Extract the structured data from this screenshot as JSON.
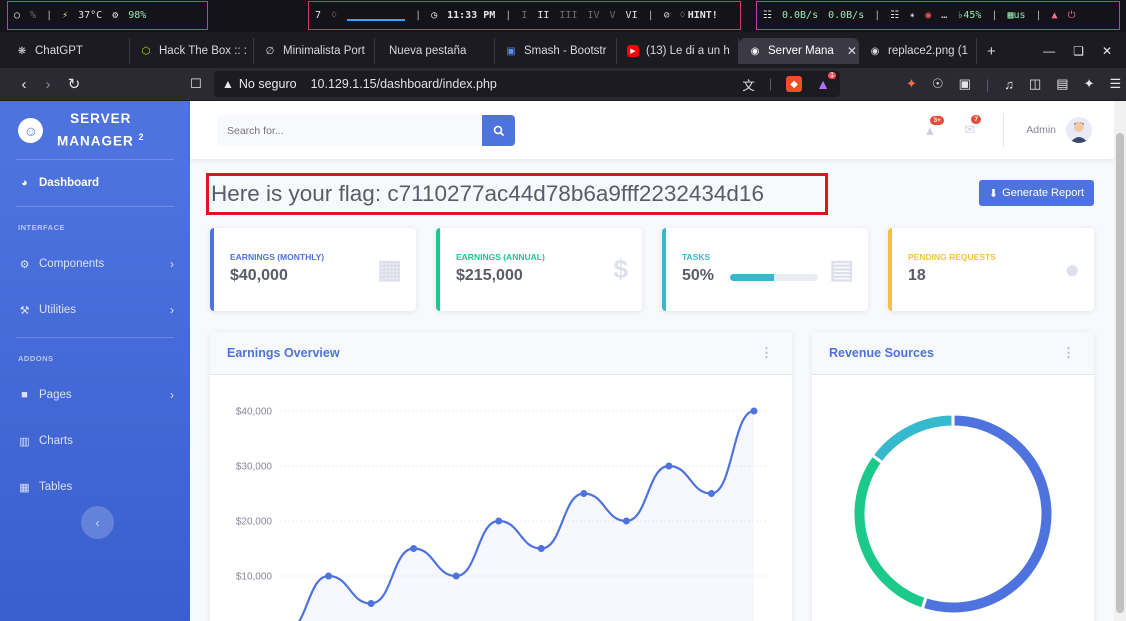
{
  "system_bar": {
    "left": [
      "37°C",
      "98%"
    ],
    "workspace_number": "7",
    "clock": "11:33 PM",
    "workspaces": [
      "I",
      "II",
      "III",
      "IV",
      "V",
      "VI"
    ],
    "hint": "HINT!",
    "net_up": "0.0B/s",
    "net_down": "0.0B/s",
    "volume": "45%",
    "keyboard": "us"
  },
  "tabs": [
    {
      "label": "ChatGPT",
      "icon": "chatgpt-icon"
    },
    {
      "label": "Hack The Box :: :",
      "icon": "htb-icon"
    },
    {
      "label": "Minimalista Port",
      "icon": "slash-icon"
    },
    {
      "label": "Nueva pestaña",
      "icon": ""
    },
    {
      "label": "Smash - Bootstr",
      "icon": "monitor-icon"
    },
    {
      "label": "(13) Le di a un h",
      "icon": "youtube-icon"
    },
    {
      "label": "Server Mana",
      "icon": "globe-icon",
      "active": true
    },
    {
      "label": "replace2.png (1",
      "icon": "globe-icon"
    }
  ],
  "address": {
    "security": "No seguro",
    "url": "10.129.1.15/dashboard/index.php",
    "brave_badge": "1"
  },
  "sidebar": {
    "brand_line1": "SERVER",
    "brand_line2": "MANAGER",
    "brand_sup": "2",
    "dashboard": "Dashboard",
    "heading_interface": "INTERFACE",
    "components": "Components",
    "utilities": "Utilities",
    "heading_addons": "ADDONS",
    "pages": "Pages",
    "charts": "Charts",
    "tables": "Tables"
  },
  "topbar": {
    "search_placeholder": "Search for...",
    "alerts_badge": "3+",
    "messages_badge": "7",
    "user": "Admin"
  },
  "flag": "Here is your flag: c7110277ac44d78b6a9fff2232434d16",
  "report_button": "Generate Report",
  "cards": [
    {
      "label": "EARNINGS (MONTHLY)",
      "value": "$40,000",
      "color": "#4e73df",
      "icon": "calendar-icon"
    },
    {
      "label": "EARNINGS (ANNUAL)",
      "value": "$215,000",
      "color": "#1cc88a",
      "icon": "dollar-icon"
    },
    {
      "label": "TASKS",
      "value": "50%",
      "color": "#36b9cc",
      "icon": "clipboard-icon",
      "progress": 0.5
    },
    {
      "label": "PENDING REQUESTS",
      "value": "18",
      "color": "#f6c23e",
      "icon": "comments-icon"
    }
  ],
  "earnings_panel": {
    "title": "Earnings Overview"
  },
  "revenue_panel": {
    "title": "Revenue Sources"
  },
  "chart_data": [
    {
      "type": "area",
      "ylabel_ticks": [
        "$10,000",
        "$20,000",
        "$30,000",
        "$40,000"
      ],
      "ylim": [
        0,
        40000
      ],
      "values": [
        0,
        10000,
        5000,
        15000,
        10000,
        20000,
        15000,
        25000,
        20000,
        30000,
        25000,
        40000
      ],
      "color": "#4e73df",
      "grid": true
    },
    {
      "type": "pie",
      "values": [
        55,
        30,
        15
      ],
      "colors": [
        "#4e73df",
        "#1cc88a",
        "#36b9cc"
      ]
    }
  ]
}
